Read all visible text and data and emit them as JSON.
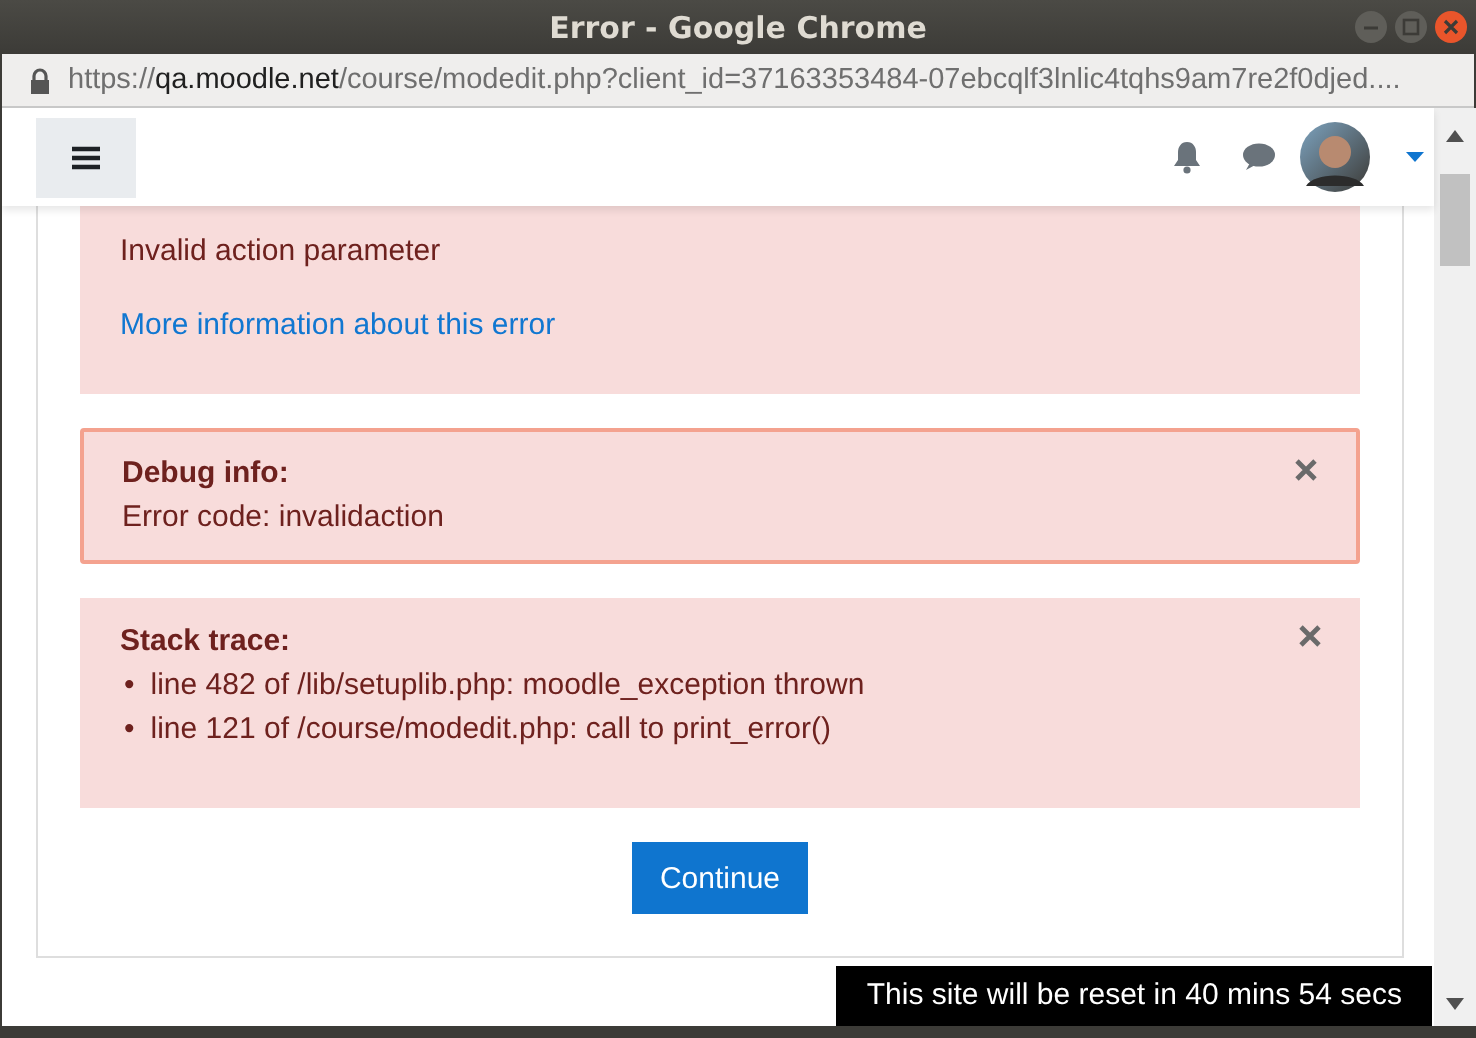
{
  "window": {
    "title": "Error - Google Chrome"
  },
  "address_bar": {
    "scheme": "https://",
    "host": "qa.moodle.net",
    "path": "/course/modedit.php?client_id=37163353484-07ebcqlf3lnlic4tqhs9am7re2f0djed...."
  },
  "alerts": [
    {
      "kind": "message",
      "text": "Invalid action parameter",
      "link": "More information about this error"
    },
    {
      "kind": "debug",
      "title": "Debug info:",
      "lines": [
        "Error code: invalidaction"
      ],
      "closable": true
    },
    {
      "kind": "trace",
      "title": "Stack trace:",
      "items": [
        {
          "bullet": "•",
          "text": "line 482 of /lib/setuplib.php: moodle_exception thrown"
        },
        {
          "bullet": "•",
          "text": "line 121 of /course/modedit.php: call to print_error()"
        }
      ],
      "closable": true
    }
  ],
  "continue_button": "Continue",
  "notice": "This site will be reset in 40 mins 54 secs"
}
